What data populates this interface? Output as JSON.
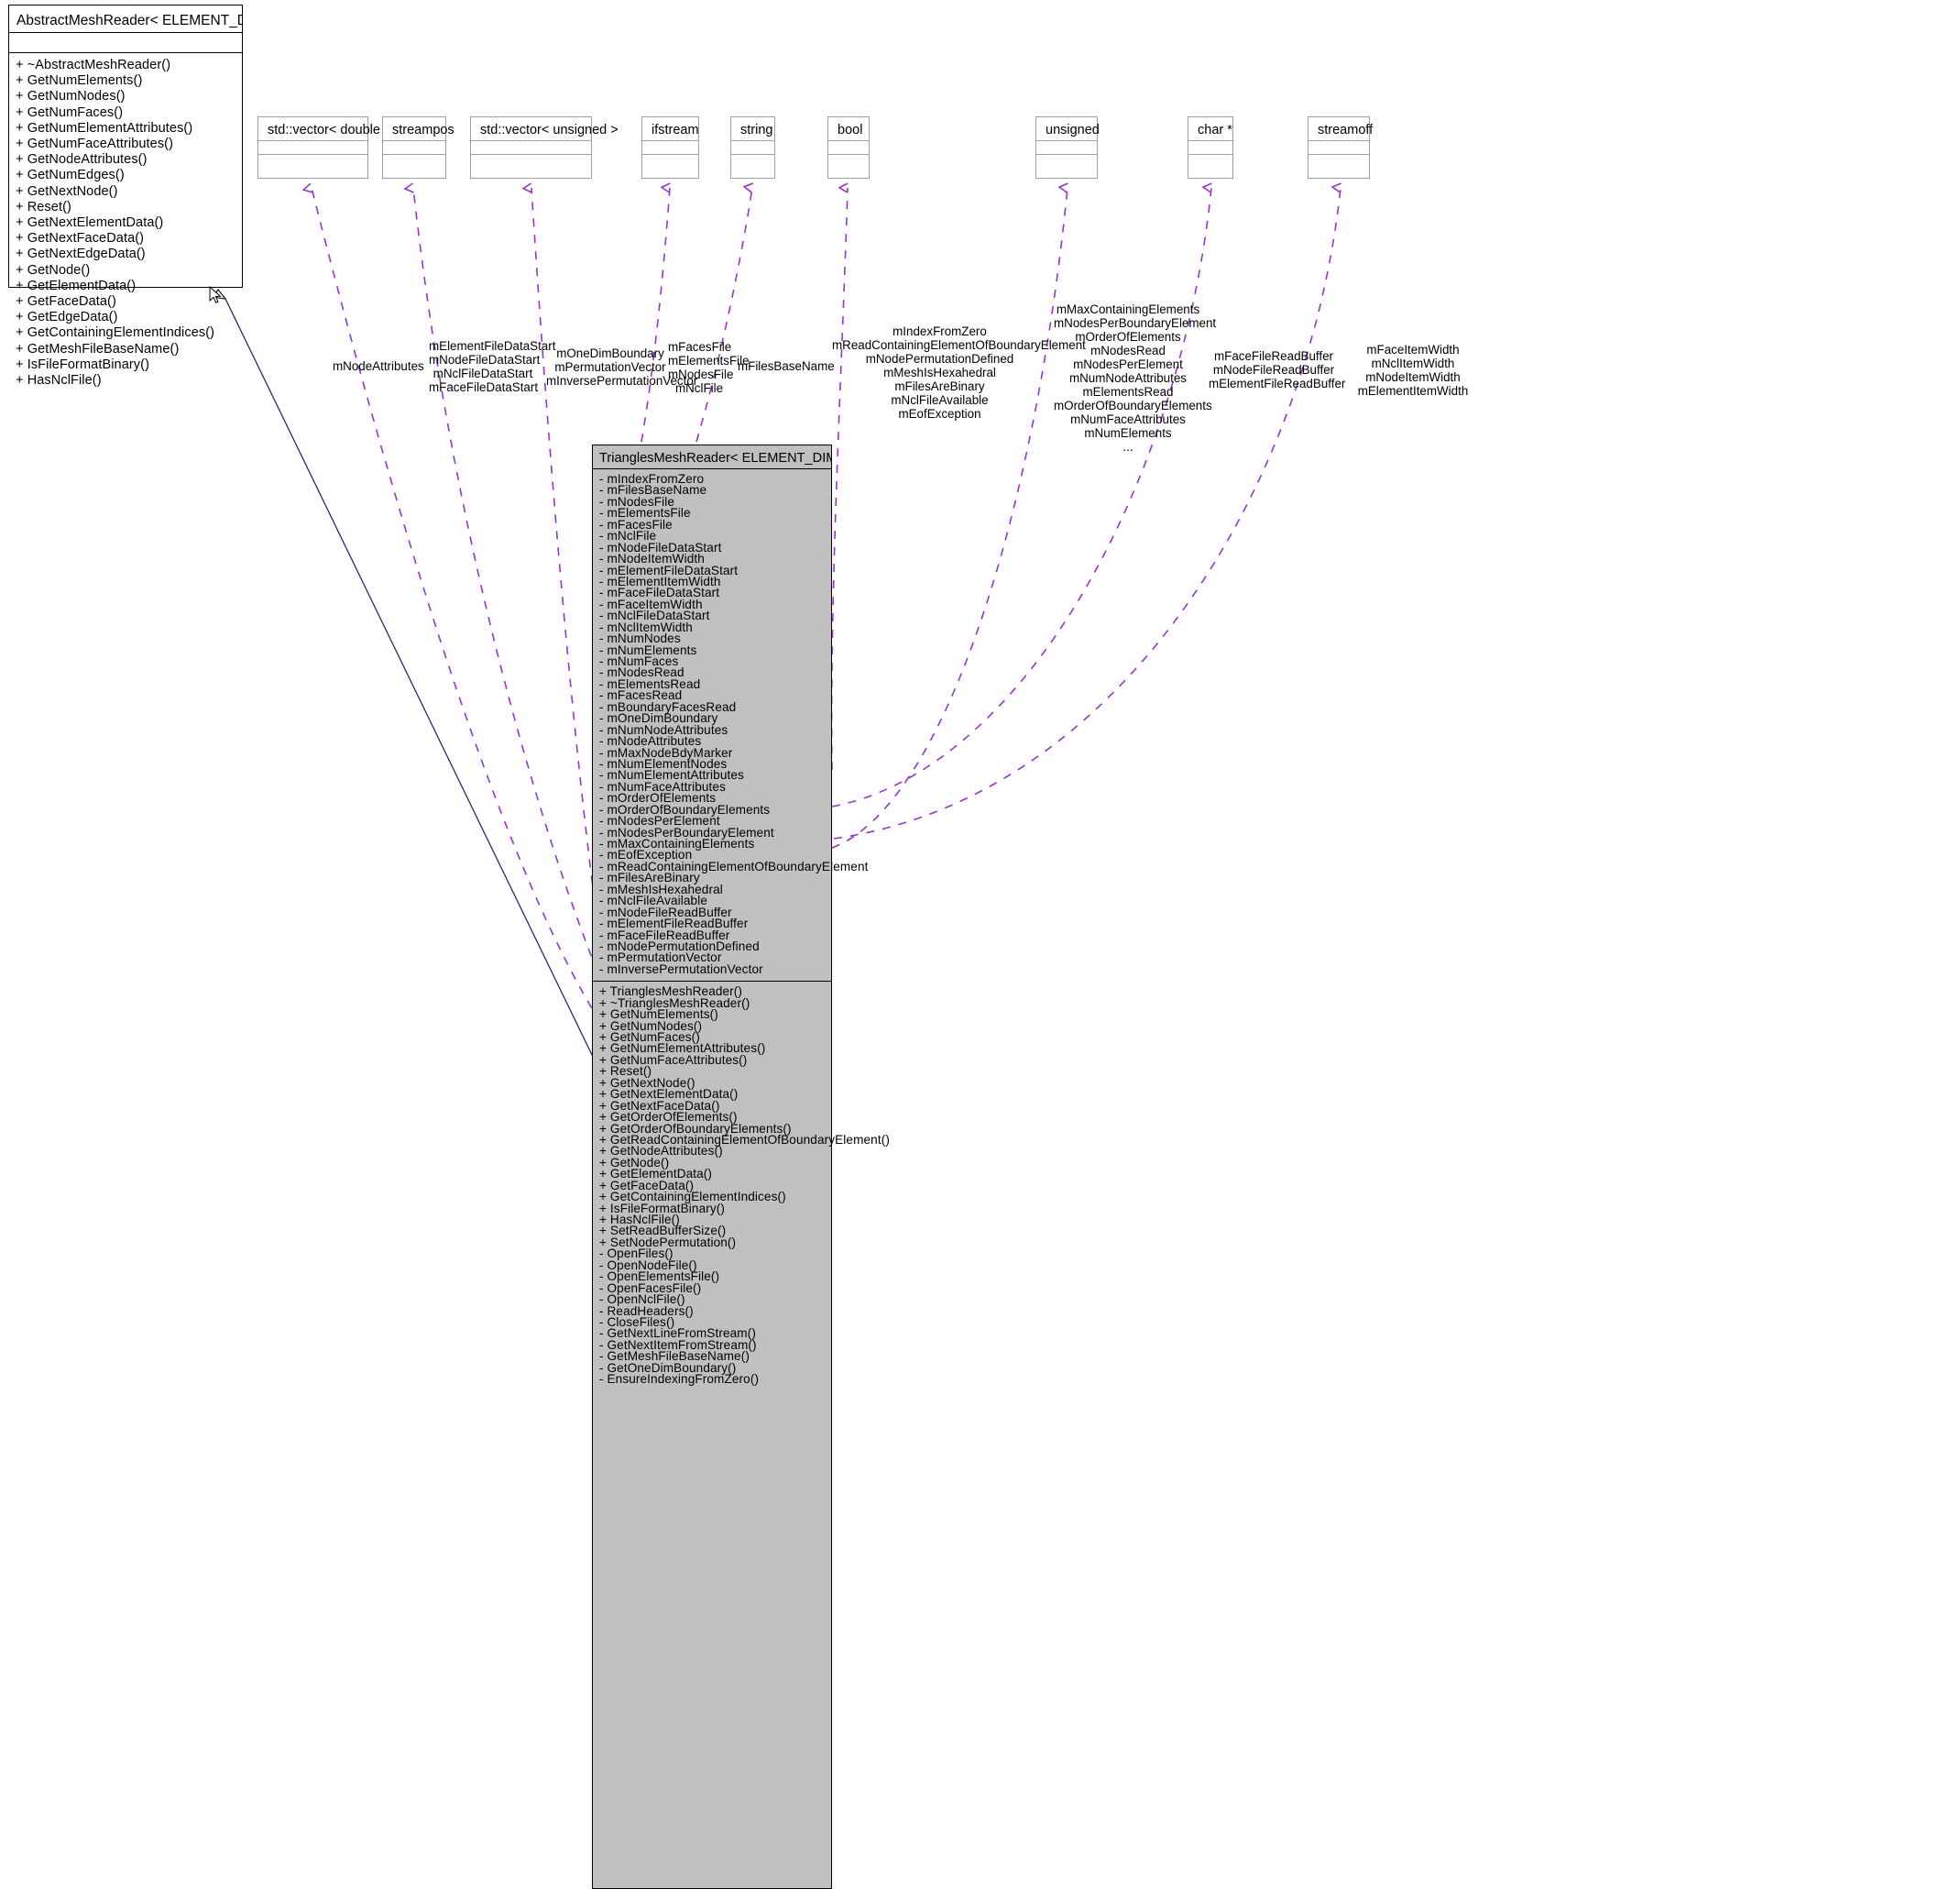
{
  "diagram": {
    "kind": "uml-class-collaboration-diagram",
    "colors": {
      "derived_fill": "#c0c0c0",
      "association_edge": "#9933cc",
      "inheritance_edge": "#1a1a6e",
      "box_border": "#000000",
      "type_box_border": "#a0a0a0",
      "background": "#ffffff"
    }
  },
  "base_class": {
    "name": "AbstractMeshReader< ELEMENT_DIM, SPACE_DIM >",
    "attributes": [],
    "methods": [
      "+ ~AbstractMeshReader()",
      "+ GetNumElements()",
      "+ GetNumNodes()",
      "+ GetNumFaces()",
      "+ GetNumElementAttributes()",
      "+ GetNumFaceAttributes()",
      "+ GetNodeAttributes()",
      "+ GetNumEdges()",
      "+ GetNextNode()",
      "+ Reset()",
      "+ GetNextElementData()",
      "+ GetNextFaceData()",
      "+ GetNextEdgeData()",
      "+ GetNode()",
      "+ GetElementData()",
      "+ GetFaceData()",
      "+ GetEdgeData()",
      "+ GetContainingElementIndices()",
      "+ GetMeshFileBaseName()",
      "+ IsFileFormatBinary()",
      "+ HasNclFile()"
    ]
  },
  "derived_class": {
    "name": "TrianglesMeshReader< ELEMENT_DIM, SPACE_DIM >",
    "attributes": [
      "- mIndexFromZero",
      "- mFilesBaseName",
      "- mNodesFile",
      "- mElementsFile",
      "- mFacesFile",
      "- mNclFile",
      "- mNodeFileDataStart",
      "- mNodeItemWidth",
      "- mElementFileDataStart",
      "- mElementItemWidth",
      "- mFaceFileDataStart",
      "- mFaceItemWidth",
      "- mNclFileDataStart",
      "- mNclItemWidth",
      "- mNumNodes",
      "- mNumElements",
      "- mNumFaces",
      "- mNodesRead",
      "- mElementsRead",
      "- mFacesRead",
      "- mBoundaryFacesRead",
      "- mOneDimBoundary",
      "- mNumNodeAttributes",
      "- mNodeAttributes",
      "- mMaxNodeBdyMarker",
      "- mNumElementNodes",
      "- mNumElementAttributes",
      "- mNumFaceAttributes",
      "- mOrderOfElements",
      "- mOrderOfBoundaryElements",
      "- mNodesPerElement",
      "- mNodesPerBoundaryElement",
      "- mMaxContainingElements",
      "- mEofException",
      "- mReadContainingElementOfBoundaryElement",
      "- mFilesAreBinary",
      "- mMeshIsHexahedral",
      "- mNclFileAvailable",
      "- mNodeFileReadBuffer",
      "- mElementFileReadBuffer",
      "- mFaceFileReadBuffer",
      "- mNodePermutationDefined",
      "- mPermutationVector",
      "- mInversePermutationVector"
    ],
    "methods": [
      "+ TrianglesMeshReader()",
      "+ ~TrianglesMeshReader()",
      "+ GetNumElements()",
      "+ GetNumNodes()",
      "+ GetNumFaces()",
      "+ GetNumElementAttributes()",
      "+ GetNumFaceAttributes()",
      "+ Reset()",
      "+ GetNextNode()",
      "+ GetNextElementData()",
      "+ GetNextFaceData()",
      "+ GetOrderOfElements()",
      "+ GetOrderOfBoundaryElements()",
      "+ GetReadContainingElementOfBoundaryElement()",
      "+ GetNodeAttributes()",
      "+ GetNode()",
      "+ GetElementData()",
      "+ GetFaceData()",
      "+ GetContainingElementIndices()",
      "+ IsFileFormatBinary()",
      "+ HasNclFile()",
      "+ SetReadBufferSize()",
      "+ SetNodePermutation()",
      "- OpenFiles()",
      "- OpenNodeFile()",
      "- OpenElementsFile()",
      "- OpenFacesFile()",
      "- OpenNclFile()",
      "- ReadHeaders()",
      "- CloseFiles()",
      "- GetNextLineFromStream()",
      "- GetNextItemFromStream()",
      "- GetMeshFileBaseName()",
      "- GetOneDimBoundary()",
      "- EnsureIndexingFromZero()"
    ]
  },
  "type_nodes": [
    {
      "id": "vector-double",
      "name": "std::vector< double >"
    },
    {
      "id": "streampos",
      "name": "streampos"
    },
    {
      "id": "vector-unsigned",
      "name": "std::vector< unsigned >"
    },
    {
      "id": "ifstream",
      "name": "ifstream"
    },
    {
      "id": "string",
      "name": "string"
    },
    {
      "id": "bool",
      "name": "bool"
    },
    {
      "id": "unsigned",
      "name": "unsigned"
    },
    {
      "id": "char-ptr",
      "name": "char *"
    },
    {
      "id": "streamoff",
      "name": "streamoff"
    }
  ],
  "edge_labels": [
    {
      "id": "label-vector-double",
      "for": "vector-double",
      "lines": [
        "mNodeAttributes"
      ]
    },
    {
      "id": "label-streampos",
      "for": "streampos",
      "lines": [
        "mElementFileDataStart",
        "mNodeFileDataStart",
        "mNclFileDataStart",
        "mFaceFileDataStart"
      ]
    },
    {
      "id": "label-vector-unsigned",
      "for": "vector-unsigned",
      "lines": [
        "mOneDimBoundary",
        "mPermutationVector",
        "mInversePermutationVector"
      ]
    },
    {
      "id": "label-ifstream",
      "for": "ifstream",
      "lines": [
        "mFacesFile",
        "mElementsFile",
        "mNodesFile",
        "mNclFile"
      ]
    },
    {
      "id": "label-string",
      "for": "string",
      "lines": [
        "mFilesBaseName"
      ]
    },
    {
      "id": "label-bool",
      "for": "bool",
      "lines": [
        "mIndexFromZero",
        "mReadContainingElementOfBoundaryElement",
        "mNodePermutationDefined",
        "mMeshIsHexahedral",
        "mFilesAreBinary",
        "mNclFileAvailable",
        "mEofException"
      ]
    },
    {
      "id": "label-unsigned",
      "for": "unsigned",
      "lines": [
        "mMaxContainingElements",
        "mNodesPerBoundaryElement",
        "mOrderOfElements",
        "mNodesRead",
        "mNodesPerElement",
        "mNumNodeAttributes",
        "mElementsRead",
        "mOrderOfBoundaryElements",
        "mNumFaceAttributes",
        "mNumElements",
        "..."
      ]
    },
    {
      "id": "label-char-ptr",
      "for": "char-ptr",
      "lines": [
        "mFaceFileReadBuffer",
        "mNodeFileReadBuffer",
        "mElementFileReadBuffer"
      ]
    },
    {
      "id": "label-streamoff",
      "for": "streamoff",
      "lines": [
        "mFaceItemWidth",
        "mNclItemWidth",
        "mNodeItemWidth",
        "mElementItemWidth"
      ]
    }
  ]
}
